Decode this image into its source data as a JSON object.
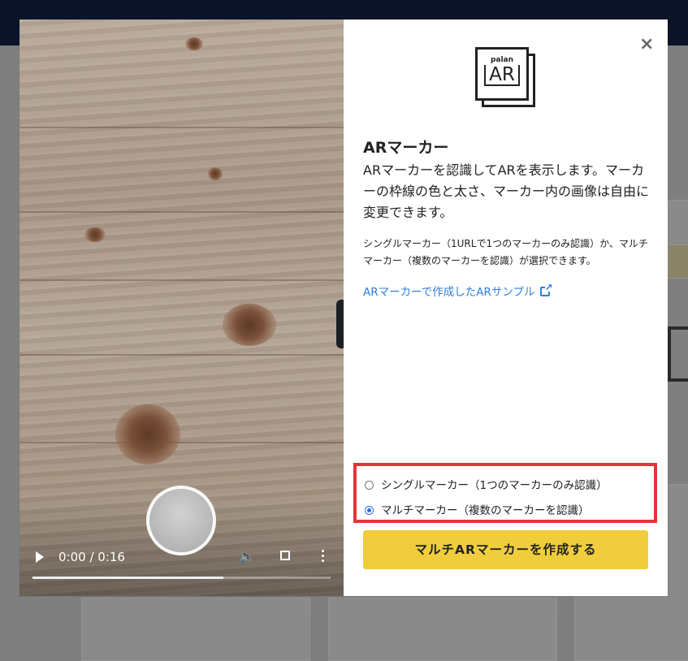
{
  "modal": {
    "close_label": "×",
    "logo": {
      "small_text": "palan",
      "big_text": "AR"
    },
    "title": "ARマーカー",
    "lead": "ARマーカーを認識してARを表示します。マーカーの枠線の色と太さ、マーカー内の画像は自由に変更できます。",
    "sub": "シングルマーカー（1URLで1つのマーカーのみ認識）か、マルチマーカー（複数のマーカーを認識）が選択できます。",
    "link_label": "ARマーカーで作成したARサンプル",
    "options": [
      {
        "label": "シングルマーカー（1つのマーカーのみ認識）",
        "selected": false
      },
      {
        "label": "マルチマーカー（複数のマーカーを認識）",
        "selected": true
      }
    ],
    "cta_label": "マルチARマーカーを作成する"
  },
  "video": {
    "time_display": "0:00 / 0:16",
    "progress": 0.64
  },
  "icons": [
    "close-icon",
    "play-icon",
    "volume-icon",
    "fullscreen-icon",
    "more-options-icon",
    "external-link-icon"
  ]
}
